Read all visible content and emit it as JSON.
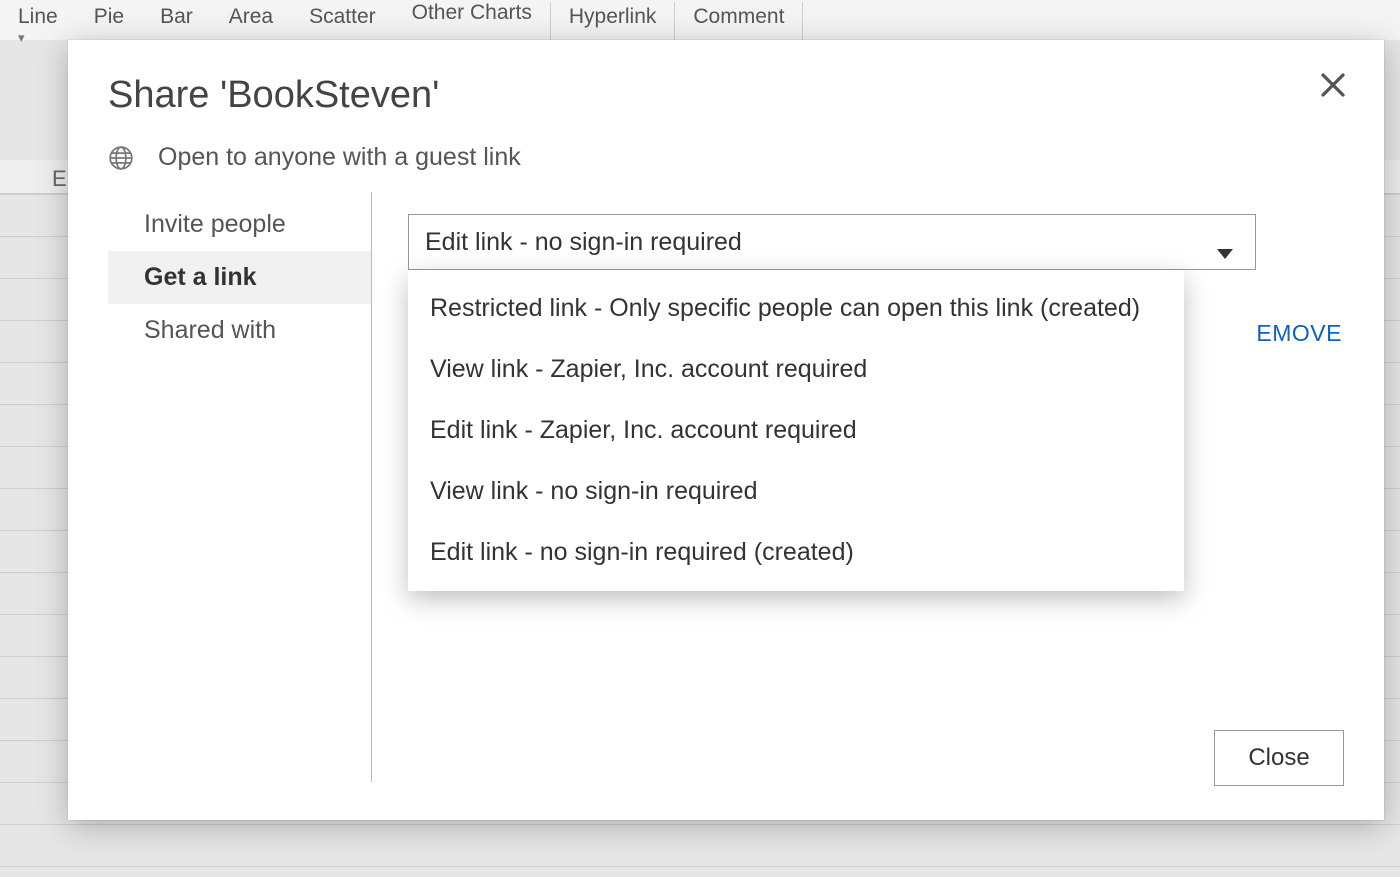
{
  "ribbon": {
    "items": [
      "Line",
      "Pie",
      "Bar",
      "Area",
      "Scatter",
      "Other Charts",
      "Hyperlink",
      "Comment"
    ],
    "dropdown_glyph": "▾"
  },
  "sheet": {
    "visible_column_header": "E"
  },
  "dialog": {
    "title": "Share 'BookSteven'",
    "status": "Open to anyone with a guest link",
    "nav": {
      "invite": "Invite people",
      "get_link": "Get a link",
      "shared_with": "Shared with"
    },
    "select": {
      "current": "Edit link - no sign-in required",
      "options": [
        "Restricted link - Only specific people can open this link (created)",
        "View link - Zapier, Inc. account required",
        "Edit link - Zapier, Inc. account required",
        "View link - no sign-in required",
        "Edit link - no sign-in required (created)"
      ]
    },
    "remove_fragment": "EMOVE",
    "close_button": "Close"
  }
}
